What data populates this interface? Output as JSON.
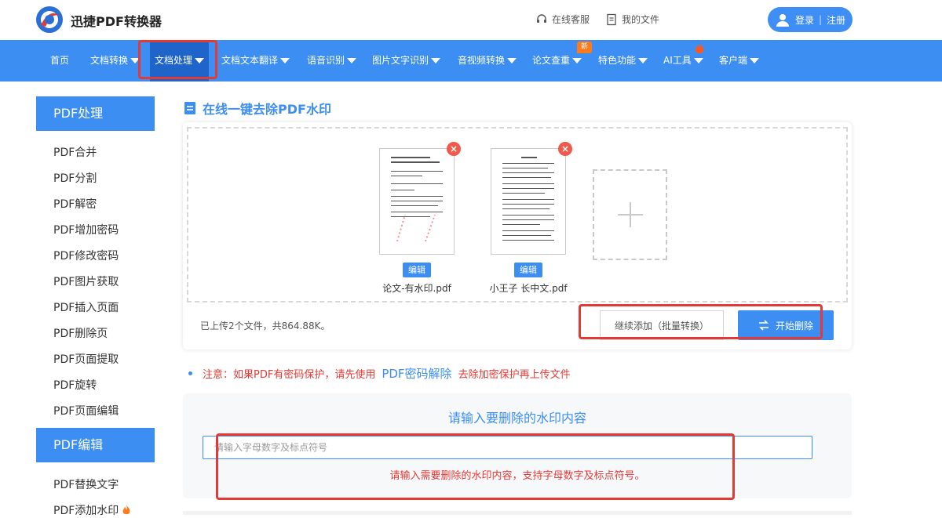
{
  "header": {
    "brand": "迅捷PDF转换器",
    "service": "在线客服",
    "my_files": "我的文件",
    "login": "登录",
    "separator": "|",
    "register": "注册"
  },
  "nav": {
    "items": [
      "首页",
      "文档转换",
      "文档处理",
      "文档文本翻译",
      "语音识别",
      "图片文字识别",
      "音视频转换",
      "论文查重",
      "特色功能",
      "AI工具",
      "客户端"
    ],
    "new_badge": "新"
  },
  "sidebar": {
    "section1": "PDF处理",
    "items1": [
      "PDF合并",
      "PDF分割",
      "PDF解密",
      "PDF增加密码",
      "PDF修改密码",
      "PDF图片获取",
      "PDF插入页面",
      "PDF删除页",
      "PDF页面提取",
      "PDF旋转",
      "PDF页面编辑"
    ],
    "section2": "PDF编辑",
    "items2": [
      "PDF替换文字",
      "PDF添加水印"
    ]
  },
  "main": {
    "title": "在线一键去除PDF水印",
    "files": [
      {
        "name": "论文-有水印.pdf",
        "edit": "编辑"
      },
      {
        "name": "小王子 长中文.pdf",
        "edit": "编辑"
      }
    ],
    "uploaded_info": "已上传2个文件，共864.88K。",
    "continue_btn": "继续添加（批量转换）",
    "start_btn": "开始删除",
    "notice_prefix": "注意：如果PDF有密码保护，请先使用",
    "notice_link": "PDF密码解除",
    "notice_suffix": "去除加密保护再上传文件",
    "wm_title": "请输入要删除的水印内容",
    "wm_placeholder": "请输入字母数字及标点符号",
    "wm_hint": "请输入需要删除的水印内容，支持字母数字及标点符号。"
  },
  "colors": {
    "accent": "#3c8ef2",
    "nav_active": "#1f64c8",
    "highlight": "#e53935",
    "badge": "#ff7a1a"
  }
}
